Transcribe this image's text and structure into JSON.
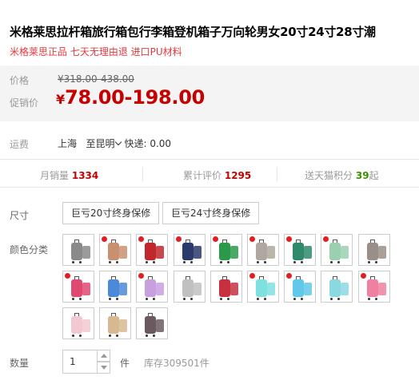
{
  "title": "米格莱思拉杆箱旅行箱包行李箱登机箱子万向轮男女20寸24寸28寸潮",
  "subtitle": "米格莱思正品 七天无理由退 进口PU材料",
  "price": {
    "label": "价格",
    "original": "¥318.00-438.00",
    "promo_label": "促销价",
    "currency": "¥",
    "promo": "78.00-198.00"
  },
  "shipping": {
    "label": "运费",
    "from": "上海",
    "to": "至昆明",
    "express": "快递: 0.00"
  },
  "stats": {
    "monthly_sales_label": "月销量",
    "monthly_sales": "1334",
    "reviews_label": "累计评价",
    "reviews": "1295",
    "points_prefix": "送天猫积分",
    "points": "39",
    "points_suffix": "起"
  },
  "size": {
    "label": "尺寸",
    "options": [
      "巨亏20寸终身保修",
      "巨亏24寸终身保修"
    ]
  },
  "color": {
    "label": "颜色分类",
    "swatches": [
      {
        "color": "#8a8a8a",
        "badge": false
      },
      {
        "color": "#c8906e",
        "badge": true
      },
      {
        "color": "#c0282e",
        "badge": true
      },
      {
        "color": "#2a3a6a",
        "badge": true
      },
      {
        "color": "#2a9a4a",
        "badge": true
      },
      {
        "color": "#b0a8a0",
        "badge": true
      },
      {
        "color": "#2e8a6a",
        "badge": true
      },
      {
        "color": "#9ad0b0",
        "badge": true
      },
      {
        "color": "#9a8f88",
        "badge": false
      },
      {
        "color": "#e04870",
        "badge": true
      },
      {
        "color": "#4a8ad8",
        "badge": false
      },
      {
        "color": "#c8a0e0",
        "badge": true
      },
      {
        "color": "#c0c0c0",
        "badge": false
      },
      {
        "color": "#c83040",
        "badge": false
      },
      {
        "color": "#7fe0e0",
        "badge": true
      },
      {
        "color": "#60c8e8",
        "badge": true
      },
      {
        "color": "#8ad8e0",
        "badge": false
      },
      {
        "color": "#f080a0",
        "badge": true
      },
      {
        "color": "#f4c8d0",
        "badge": false
      },
      {
        "color": "#d8b890",
        "badge": false
      },
      {
        "color": "#6a5a60",
        "badge": false
      }
    ]
  },
  "quantity": {
    "label": "数量",
    "value": "1",
    "unit": "件",
    "stock": "库存309501件"
  }
}
